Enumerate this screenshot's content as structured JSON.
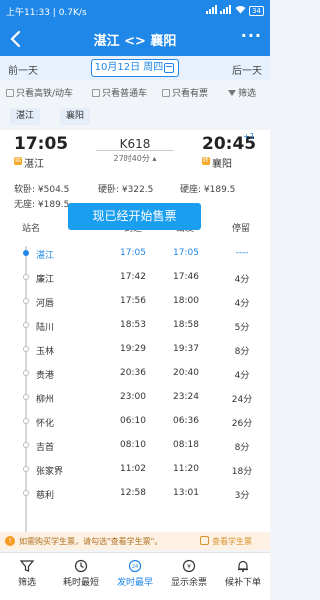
{
  "status": {
    "time": "上午11:33",
    "speed": "0.7K/s",
    "battery": "34"
  },
  "header": {
    "title": "湛江 <> 襄阳",
    "more": "···"
  },
  "datebar": {
    "prev": "前一天",
    "date": "10月12日 周四",
    "next": "后一天"
  },
  "filters": [
    {
      "label": "只看高铁/动车"
    },
    {
      "label": "只看普通车"
    },
    {
      "label": "只看有票"
    },
    {
      "label": "筛选"
    }
  ],
  "chips": [
    "湛江",
    "襄阳"
  ],
  "train": {
    "dep_time": "17:05",
    "dep_badge": "始",
    "dep_station": "湛江",
    "number": "K618",
    "duration": "27时40分",
    "arr_time": "20:45",
    "plus_day": "+1",
    "arr_badge": "终",
    "arr_station": "襄阳",
    "prices": [
      {
        "label": "软卧: ¥504.5"
      },
      {
        "label": "硬卧: ¥322.5"
      },
      {
        "label": "硬座: ¥189.5"
      },
      {
        "label": "无座: ¥189.5"
      }
    ]
  },
  "toast": "现已经开始售票",
  "table": {
    "headers": {
      "station": "站名",
      "arrive": "到达",
      "depart": "出发",
      "stop": "停留"
    },
    "rows": [
      {
        "station": "湛江",
        "arrive": "17:05",
        "depart": "17:05",
        "stop": "----"
      },
      {
        "station": "廉江",
        "arrive": "17:42",
        "depart": "17:46",
        "stop": "4分"
      },
      {
        "station": "河唇",
        "arrive": "17:56",
        "depart": "18:00",
        "stop": "4分"
      },
      {
        "station": "陆川",
        "arrive": "18:53",
        "depart": "18:58",
        "stop": "5分"
      },
      {
        "station": "玉林",
        "arrive": "19:29",
        "depart": "19:37",
        "stop": "8分"
      },
      {
        "station": "贵港",
        "arrive": "20:36",
        "depart": "20:40",
        "stop": "4分"
      },
      {
        "station": "柳州",
        "arrive": "23:00",
        "depart": "23:24",
        "stop": "24分"
      },
      {
        "station": "怀化",
        "arrive": "06:10",
        "depart": "06:36",
        "stop": "26分"
      },
      {
        "station": "吉首",
        "arrive": "08:10",
        "depart": "08:18",
        "stop": "8分"
      },
      {
        "station": "张家界",
        "arrive": "11:02",
        "depart": "11:20",
        "stop": "18分"
      },
      {
        "station": "慈利",
        "arrive": "12:58",
        "depart": "13:01",
        "stop": "3分"
      }
    ]
  },
  "notice": {
    "text": "如需购买学生票，请勾选\"查看学生票\"。",
    "checkbox": "查看学生票"
  },
  "tabs": [
    {
      "label": "筛选",
      "icon": "filter-icon"
    },
    {
      "label": "耗时最短",
      "icon": "clock-icon"
    },
    {
      "label": "发时最早",
      "icon": "24h-icon"
    },
    {
      "label": "显示余票",
      "icon": "ticket-icon"
    },
    {
      "label": "候补下单",
      "icon": "bell-icon"
    }
  ],
  "colors": {
    "primary": "#1f87e8",
    "toast": "#1a9ef0",
    "badge": "#f5a623",
    "notice_bg": "#fdf1e3"
  }
}
